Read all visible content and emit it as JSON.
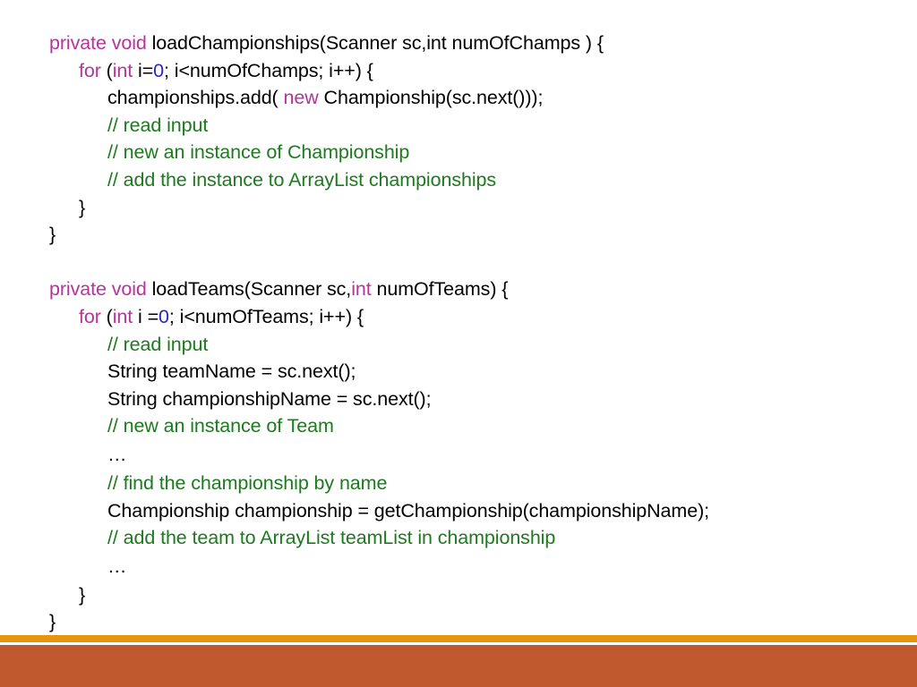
{
  "slide": {
    "background_color": "#FFFFFF",
    "language": "java"
  },
  "theme": {
    "keyword_color": "#B4359A",
    "number_color": "#2A28C8",
    "comment_color": "#1E7A1E",
    "plain_color": "#000000",
    "accent_orange": "#E8950C",
    "accent_terracotta": "#C05A2E"
  },
  "code": {
    "lines": [
      {
        "indent": 0,
        "tokens": [
          {
            "text": "private void",
            "type": "keyword"
          },
          {
            "text": " loadChampionships(Scanner sc,int numOfChamps ) {",
            "type": "plain"
          }
        ]
      },
      {
        "indent": 1,
        "tokens": [
          {
            "text": "for",
            "type": "keyword"
          },
          {
            "text": " (",
            "type": "plain"
          },
          {
            "text": "int",
            "type": "keyword"
          },
          {
            "text": " i=",
            "type": "plain"
          },
          {
            "text": "0",
            "type": "number"
          },
          {
            "text": "; i<numOfChamps; i++) {",
            "type": "plain"
          }
        ]
      },
      {
        "indent": 2,
        "tokens": [
          {
            "text": "championships.add( ",
            "type": "plain"
          },
          {
            "text": "new",
            "type": "keyword"
          },
          {
            "text": " Championship(sc.next()));",
            "type": "plain"
          }
        ]
      },
      {
        "indent": 2,
        "tokens": [
          {
            "text": "// read input",
            "type": "comment"
          }
        ]
      },
      {
        "indent": 2,
        "tokens": [
          {
            "text": "// new an instance of Championship",
            "type": "comment"
          }
        ]
      },
      {
        "indent": 2,
        "tokens": [
          {
            "text": "// add the instance to ArrayList championships",
            "type": "comment"
          }
        ]
      },
      {
        "indent": 1,
        "tokens": [
          {
            "text": "}",
            "type": "plain"
          }
        ]
      },
      {
        "indent": 0,
        "tokens": [
          {
            "text": "}",
            "type": "plain"
          }
        ]
      },
      {
        "indent": 0,
        "blank": true,
        "tokens": []
      },
      {
        "indent": 0,
        "tokens": [
          {
            "text": "private void",
            "type": "keyword"
          },
          {
            "text": " loadTeams(Scanner sc,",
            "type": "plain"
          },
          {
            "text": "int",
            "type": "keyword"
          },
          {
            "text": " numOfTeams) {",
            "type": "plain"
          }
        ]
      },
      {
        "indent": 1,
        "tokens": [
          {
            "text": "for",
            "type": "keyword"
          },
          {
            "text": " (",
            "type": "plain"
          },
          {
            "text": "int",
            "type": "keyword"
          },
          {
            "text": " i =",
            "type": "plain"
          },
          {
            "text": "0",
            "type": "number"
          },
          {
            "text": "; i<numOfTeams; i++) {",
            "type": "plain"
          }
        ]
      },
      {
        "indent": 2,
        "tokens": [
          {
            "text": "// read input",
            "type": "comment"
          }
        ]
      },
      {
        "indent": 2,
        "tokens": [
          {
            "text": "String teamName = sc.next();",
            "type": "plain"
          }
        ]
      },
      {
        "indent": 2,
        "tokens": [
          {
            "text": "String championshipName = sc.next();",
            "type": "plain"
          }
        ]
      },
      {
        "indent": 2,
        "tokens": [
          {
            "text": "// new an instance of Team",
            "type": "comment"
          }
        ]
      },
      {
        "indent": 2,
        "ellipsis": true,
        "tokens": [
          {
            "text": "…",
            "type": "plain"
          }
        ]
      },
      {
        "indent": 2,
        "tokens": [
          {
            "text": "// find the championship by name",
            "type": "comment"
          }
        ]
      },
      {
        "indent": 2,
        "tokens": [
          {
            "text": "Championship championship = getChampionship(championshipName);",
            "type": "plain"
          }
        ]
      },
      {
        "indent": 2,
        "tokens": [
          {
            "text": "// add the team to ArrayList teamList in championship",
            "type": "comment"
          }
        ]
      },
      {
        "indent": 2,
        "ellipsis": true,
        "tokens": [
          {
            "text": "…",
            "type": "plain"
          }
        ]
      },
      {
        "indent": 1,
        "tokens": [
          {
            "text": "}",
            "type": "plain"
          }
        ]
      },
      {
        "indent": 0,
        "tokens": [
          {
            "text": "}",
            "type": "plain"
          }
        ]
      }
    ]
  }
}
